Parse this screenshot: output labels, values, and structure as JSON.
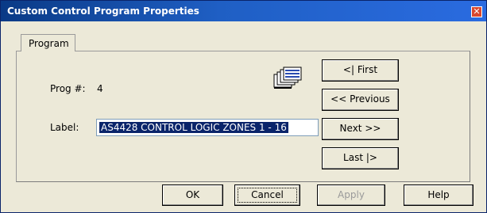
{
  "window": {
    "title": "Custom Control Program Properties"
  },
  "tabs": [
    {
      "label": "Program"
    }
  ],
  "fields": {
    "prog_label": "Prog #:",
    "prog_value": "4",
    "label_label": "Label:",
    "label_value": "AS4428 CONTROL LOGIC ZONES 1 - 16"
  },
  "nav_buttons": {
    "first": "<| First",
    "previous": "<< Previous",
    "next": "Next >>",
    "last": "Last |>"
  },
  "dialog_buttons": {
    "ok": "OK",
    "cancel": "Cancel",
    "apply": "Apply",
    "help": "Help"
  },
  "icons": {
    "close": "close-icon",
    "program": "program-stack-icon"
  },
  "colors": {
    "titlebar": "#1f5fc4",
    "selection": "#0a246a",
    "close": "#d9482f"
  }
}
